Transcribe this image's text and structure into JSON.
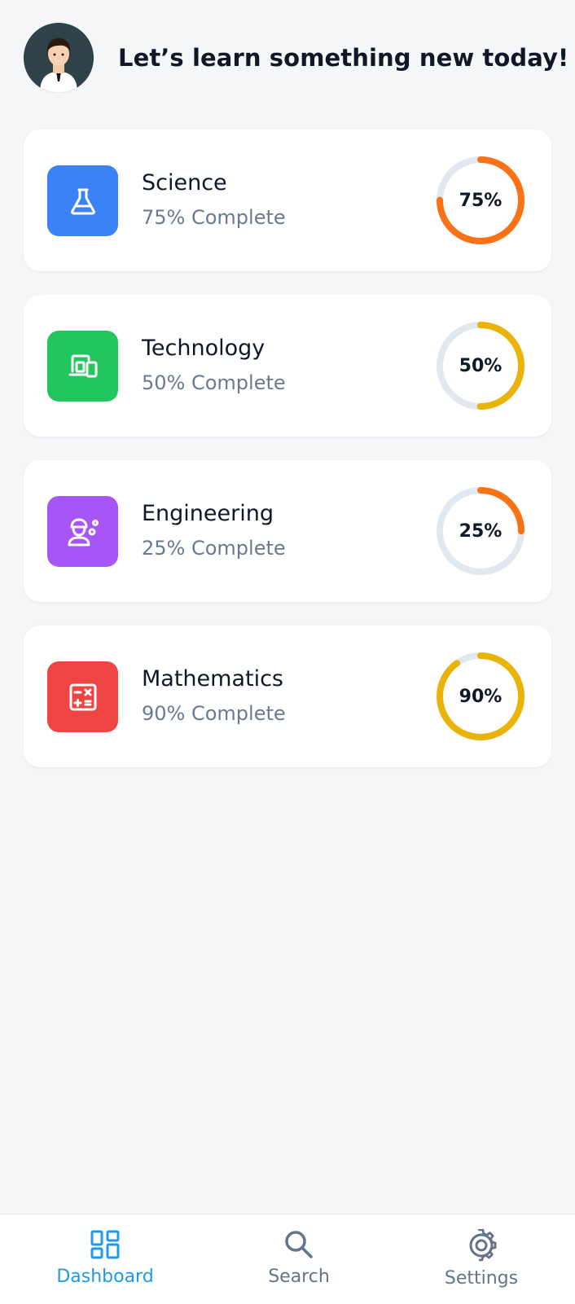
{
  "header": {
    "greeting": "Let’s learn something new today!",
    "avatar_icon": "user-avatar"
  },
  "subjects": [
    {
      "title": "Science",
      "progress_text": "75% Complete",
      "percent": 75,
      "percent_label": "75%",
      "icon": "flask-icon",
      "icon_bg": "#3b82f6",
      "ring_color": "#f97316"
    },
    {
      "title": "Technology",
      "progress_text": "50% Complete",
      "percent": 50,
      "percent_label": "50%",
      "icon": "devices-icon",
      "icon_bg": "#22c55e",
      "ring_color": "#eab308"
    },
    {
      "title": "Engineering",
      "progress_text": "25% Complete",
      "percent": 25,
      "percent_label": "25%",
      "icon": "engineer-icon",
      "icon_bg": "#a855f7",
      "ring_color": "#f97316"
    },
    {
      "title": "Mathematics",
      "progress_text": "90% Complete",
      "percent": 90,
      "percent_label": "90%",
      "icon": "calculator-icon",
      "icon_bg": "#ef4444",
      "ring_color": "#eab308"
    }
  ],
  "ring_track_color": "#e2e8f0",
  "nav": {
    "items": [
      {
        "label": "Dashboard",
        "icon": "dashboard-icon",
        "active": true
      },
      {
        "label": "Search",
        "icon": "search-icon",
        "active": false
      },
      {
        "label": "Settings",
        "icon": "gear-icon",
        "active": false
      }
    ],
    "active_color": "#1d9be6",
    "inactive_color": "#64748b"
  }
}
